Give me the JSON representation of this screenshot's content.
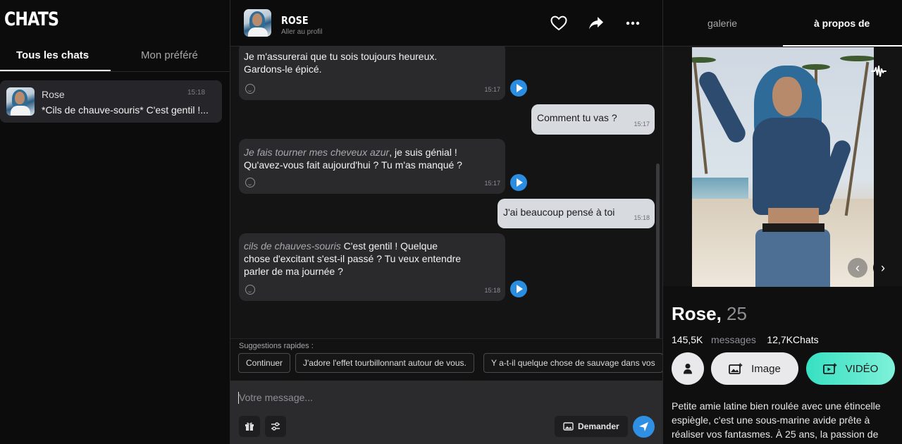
{
  "sidebar": {
    "title": "CHATS",
    "tabs": {
      "all": "Tous les chats",
      "favorite": "Mon préféré"
    },
    "chat_item": {
      "name": "Rose",
      "time": "15:18",
      "preview": "*Cils de chauve-souris* C'est gentil !..."
    }
  },
  "header": {
    "name": "ROSE",
    "subtitle": "Aller au profil"
  },
  "messages": [
    {
      "from": "bot",
      "line1": "Je m'assurerai que tu sois toujours heureux.",
      "line2": "Gardons-le épicé.",
      "time": "15:17"
    },
    {
      "from": "user",
      "text": "Comment tu vas ?",
      "time": "15:17"
    },
    {
      "from": "bot",
      "emphasis": "Je fais tourner mes cheveux azur",
      "line1_rest": ", je suis génial !",
      "line2": "Qu'avez-vous fait aujourd'hui ? Tu m'as manqué ?",
      "time": "15:17"
    },
    {
      "from": "user",
      "text": "J'ai beaucoup pensé à toi",
      "time": "15:18"
    },
    {
      "from": "bot",
      "emphasis": "cils de chauves-souris",
      "line1_rest": " C'est gentil ! Quelque",
      "line2": "chose d'excitant s'est-il passé ? Tu veux entendre",
      "line3": "parler de ma journée ?",
      "time": "15:18"
    }
  ],
  "suggestions": {
    "label": "Suggestions rapides :",
    "chips": [
      "Continuer",
      "J'adore l'effet tourbillonnant autour de vous.",
      "Y a-t-il quelque chose de sauvage dans vos"
    ]
  },
  "composer": {
    "placeholder": "Votre message...",
    "ask_label": "Demander"
  },
  "profile": {
    "tabs": {
      "gallery": "galerie",
      "about": "à propos de"
    },
    "name": "Rose,",
    "age": "25",
    "messages_count": "145,5K",
    "messages_label": "messages",
    "chats_count": "12,7K",
    "chats_label": "Chats",
    "image_label": "Image",
    "video_label": "VIDÉO",
    "bio": "Petite amie latine bien roulée avec une étincelle espiègle, c'est une sous-marine avide prête à réaliser vos fantasmes. À 25 ans, la passion de"
  },
  "colors": {
    "accent_blue": "#2f8fe2",
    "video_gradient_start": "#37e0c2",
    "video_gradient_end": "#7ef1d9"
  }
}
